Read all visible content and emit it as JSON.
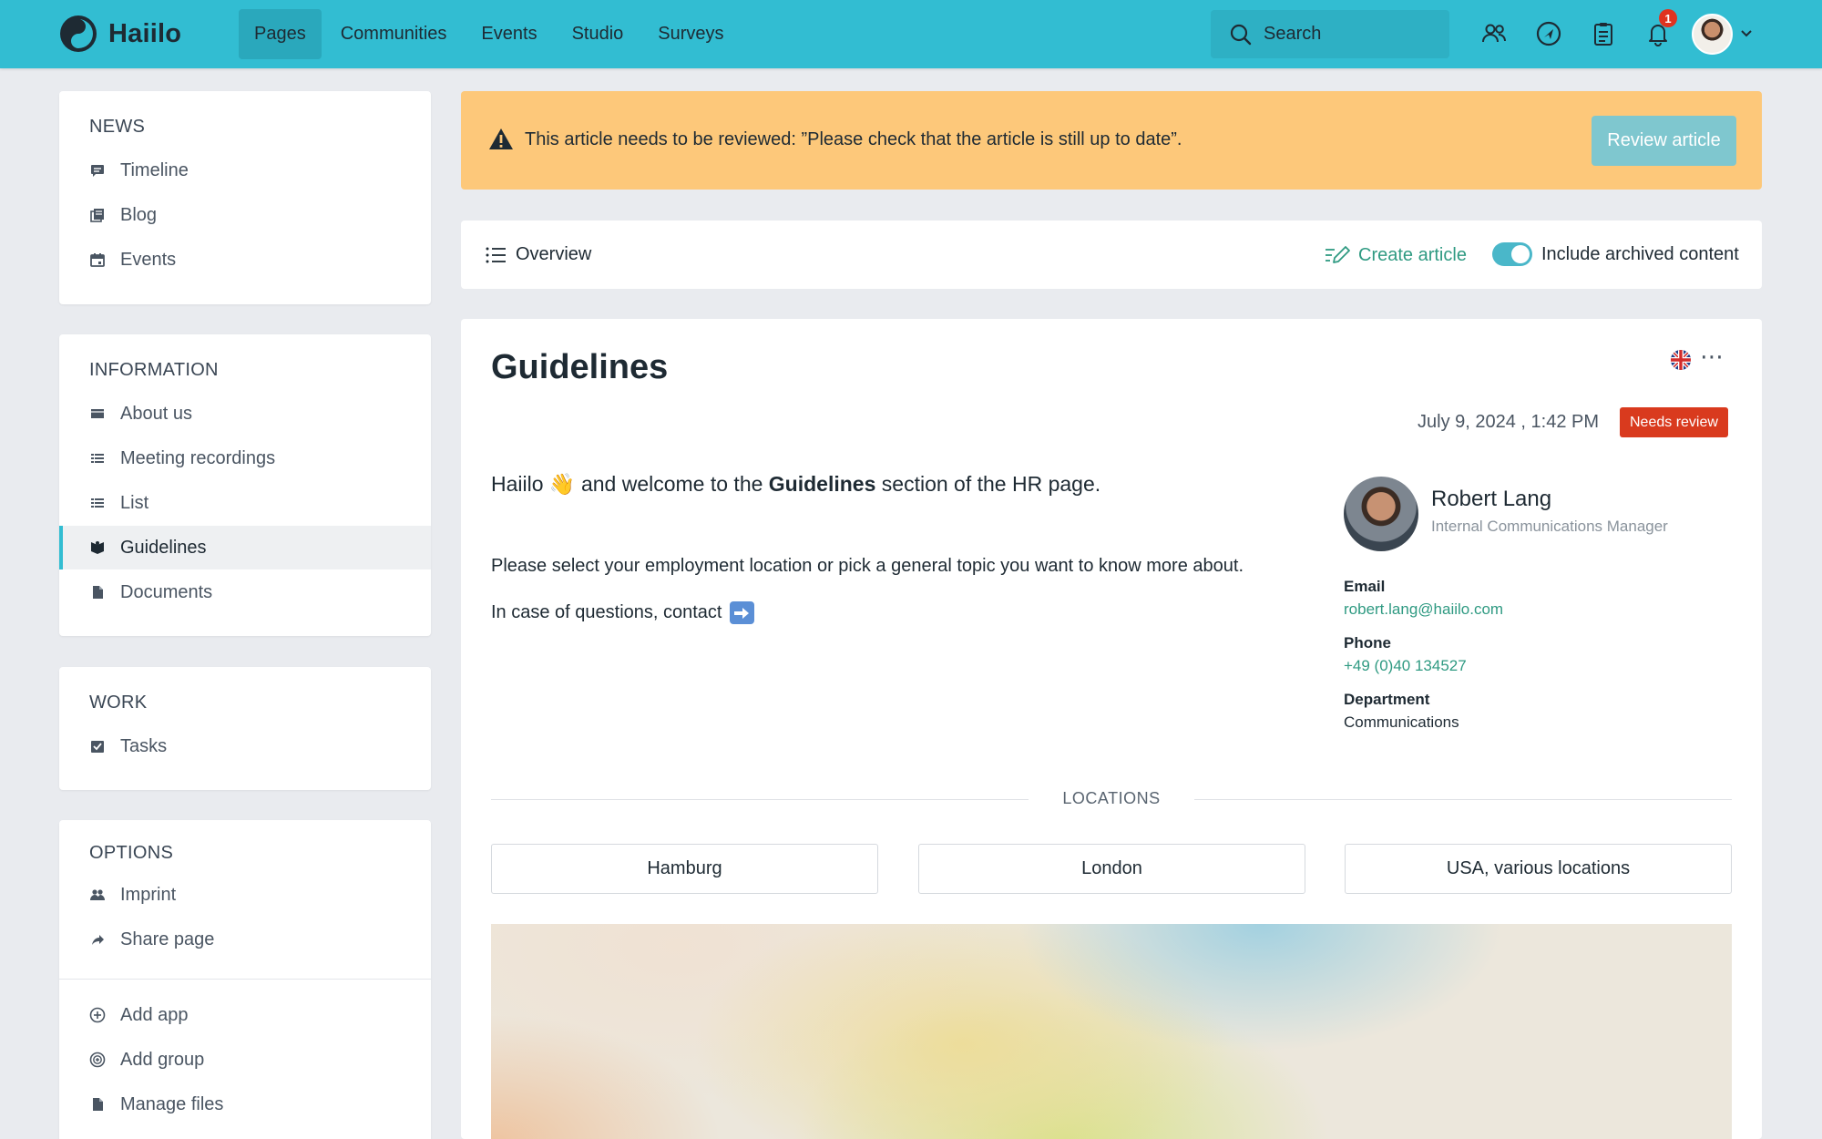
{
  "app": {
    "name": "Haiilo"
  },
  "nav": {
    "items": [
      "Pages",
      "Communities",
      "Events",
      "Studio",
      "Surveys"
    ],
    "active": "Pages"
  },
  "search": {
    "placeholder": "Search"
  },
  "notifications": {
    "count": "1"
  },
  "sidebar": {
    "news": {
      "title": "NEWS",
      "items": [
        "Timeline",
        "Blog",
        "Events"
      ]
    },
    "information": {
      "title": "INFORMATION",
      "items": [
        "About us",
        "Meeting recordings",
        "List",
        "Guidelines",
        "Documents"
      ],
      "active": "Guidelines"
    },
    "work": {
      "title": "WORK",
      "items": [
        "Tasks"
      ]
    },
    "options": {
      "title": "OPTIONS",
      "items": [
        "Imprint",
        "Share page"
      ],
      "admin_items": [
        "Add app",
        "Add group",
        "Manage files"
      ]
    }
  },
  "alert": {
    "text": "This article needs to be reviewed: ”Please check that the article is still up to date”.",
    "button": "Review article",
    "color": "#fdc87a"
  },
  "toolbar": {
    "overview": "Overview",
    "create": "Create article",
    "archived_label": "Include archived content",
    "archived_on": true
  },
  "article": {
    "title": "Guidelines",
    "date": "July 9, 2024 , 1:42 PM",
    "status": "Needs review",
    "welcome_prefix": "Haiilo",
    "welcome_emoji": "👋",
    "welcome_mid": "and welcome to the",
    "welcome_bold": "Guidelines",
    "welcome_suffix": "section of the HR page.",
    "para1": "Please select your employment location or pick a general topic you want to know more about.",
    "para2": "In case of questions, contact",
    "para2_emoji": "➡"
  },
  "contact": {
    "name": "Robert Lang",
    "role": "Internal Communications Manager",
    "email_label": "Email",
    "email": "robert.lang@haiilo.com",
    "phone_label": "Phone",
    "phone": "+49 (0)40 134527",
    "department_label": "Department",
    "department": "Communications"
  },
  "locations": {
    "title": "LOCATIONS",
    "items": [
      "Hamburg",
      "London",
      "USA, various locations"
    ]
  },
  "colors": {
    "brand": "#32bdd2",
    "link": "#2f9a82",
    "danger": "#d93a1e"
  }
}
